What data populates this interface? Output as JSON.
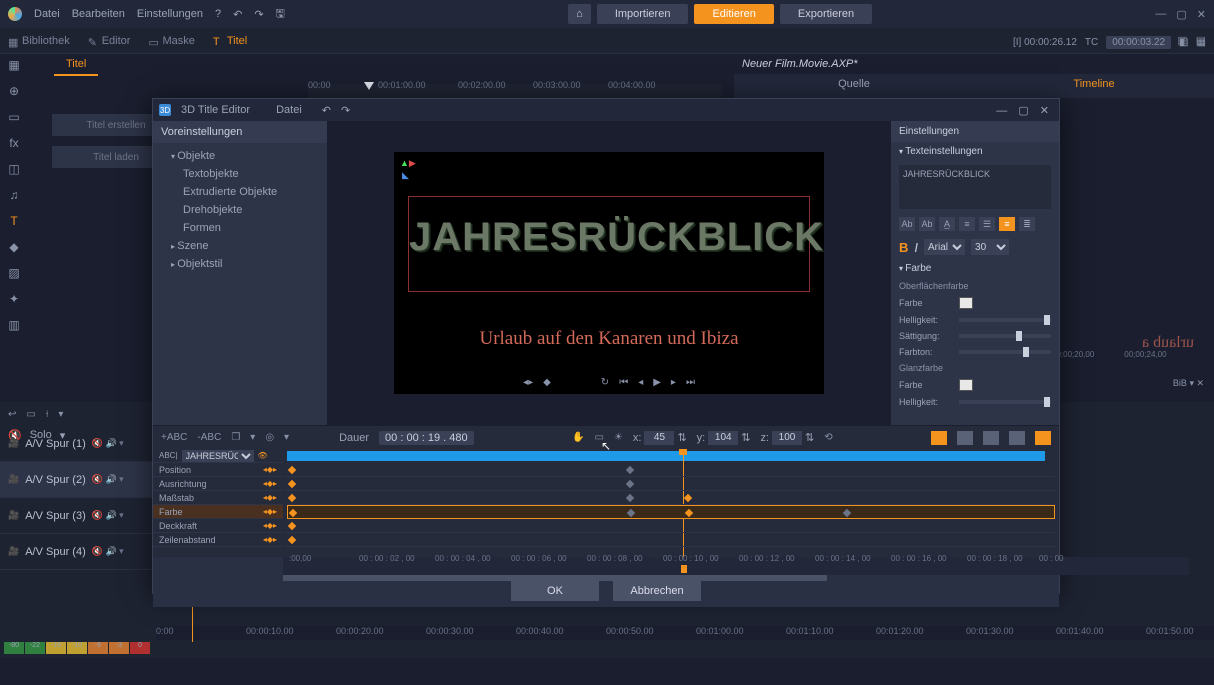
{
  "menubar": {
    "items": [
      "Datei",
      "Bearbeiten",
      "Einstellungen"
    ],
    "home": "⌂",
    "import": "Importieren",
    "edit": "Editieren",
    "export": "Exportieren"
  },
  "tabs": {
    "library": "Bibliothek",
    "editor": "Editor",
    "mask": "Maske",
    "title": "Titel"
  },
  "titelPanel": {
    "label": "Titel",
    "createBtn": "Titel erstellen",
    "loadBtn": "Titel laden",
    "ruler": [
      "00:00",
      "00:01:00.00",
      "00:02:00.00",
      "00:03:00.00",
      "00:04:00.00"
    ]
  },
  "rightPanel": {
    "file": "Neuer Film.Movie.AXP*",
    "tabs": {
      "source": "Quelle",
      "timeline": "Timeline"
    },
    "posLabel": "[I] 00:00:26.12",
    "tcLabel": "TC",
    "tc": "00:00:03.22",
    "ruler": [
      "00;00;20,00",
      "00;00;24,00"
    ],
    "watermark": "urlaub a",
    "bib": "BiB"
  },
  "dialog": {
    "title": "3D Title Editor",
    "menu": "Datei",
    "presets": {
      "header": "Voreinstellungen",
      "objekte": "Objekte",
      "children": [
        "Textobjekte",
        "Extrudierte Objekte",
        "Drehobjekte",
        "Formen"
      ],
      "szene": "Szene",
      "objektstil": "Objektstil"
    },
    "viewport": {
      "mainTitle": "JAHRESRÜCKBLICK",
      "subtitle": "Urlaub auf den Kanaren und Ibiza"
    },
    "settings": {
      "header": "Einstellungen",
      "textSection": "Texteinstellungen",
      "textValue": "JAHRESRÜCKBLICK",
      "font": "Arial",
      "size": "30",
      "colorSection": "Farbe",
      "surfaceLabel": "Oberflächenfarbe",
      "rows": {
        "farbe": "Farbe",
        "hell": "Helligkeit:",
        "satt": "Sättigung:",
        "ton": "Farbton:"
      },
      "glanz": "Glanzfarbe",
      "glanzFarbe": "Farbe",
      "glanzHell": "Helligkeit:"
    },
    "kf": {
      "dauerLabel": "Dauer",
      "dauer": "00 : 00 : 19 . 480",
      "x": "45",
      "y": "104",
      "z": "100",
      "objSel": "JAHRESRÜCKBL...",
      "labels": [
        "Position",
        "Ausrichtung",
        "Maßstab",
        "Farbe",
        "Deckkraft",
        "Zeilenabstand"
      ],
      "ruler": [
        ":00,00",
        "00 : 00 : 02 , 00",
        "00 : 00 : 04 , 00",
        "00 : 00 : 06 , 00",
        "00 : 00 : 08 , 00",
        "00 : 00 : 10 , 00",
        "00 : 00 : 12 , 00",
        "00 : 00 : 14 , 00",
        "00 : 00 : 16 , 00",
        "00 : 00 : 18 , 00",
        "00 : 00"
      ]
    },
    "footer": {
      "ok": "OK",
      "cancel": "Abbrechen"
    }
  },
  "mainTl": {
    "solo": "Solo",
    "tracks": [
      "A/V Spur (1)",
      "A/V Spur (2)",
      "A/V Spur (3)",
      "A/V Spur (4)"
    ],
    "ruler": [
      "0:00",
      "00:00:10.00",
      "00:00:20.00",
      "00:00:30.00",
      "00:00:40.00",
      "00:00:50.00",
      "00:01:00.00",
      "00:01:10.00",
      "00:01:20.00",
      "00:01:30.00",
      "00:01:40.00",
      "00:01:50.00"
    ],
    "meter": [
      "-80",
      "-22",
      "-16",
      "-10",
      "-6",
      "-3",
      "0"
    ]
  }
}
